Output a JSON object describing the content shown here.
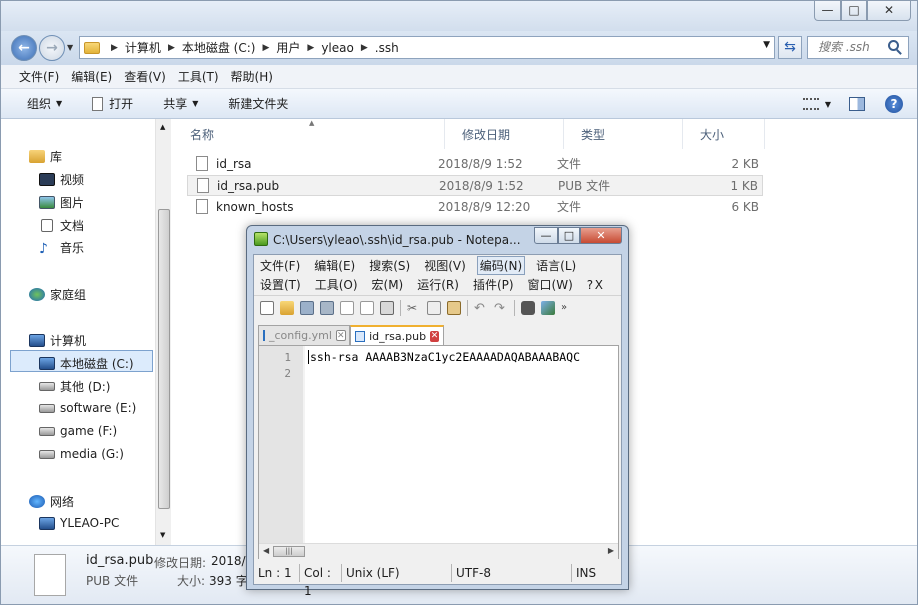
{
  "explorer": {
    "window_controls": {
      "minimize": "—",
      "maximize": "□",
      "close": "✕"
    },
    "breadcrumb": [
      "计算机",
      "本地磁盘 (C:)",
      "用户",
      "yleao",
      ".ssh"
    ],
    "search_placeholder": "搜索 .ssh",
    "menu": [
      "文件(F)",
      "编辑(E)",
      "查看(V)",
      "工具(T)",
      "帮助(H)"
    ],
    "toolbar": {
      "organize": "组织",
      "open": "打开",
      "share": "共享",
      "new_folder": "新建文件夹"
    },
    "nav": {
      "library": "库",
      "video": "视频",
      "pictures": "图片",
      "documents": "文档",
      "music": "音乐",
      "homegroup": "家庭组",
      "computer": "计算机",
      "drive_c": "本地磁盘 (C:)",
      "drive_d": "其他 (D:)",
      "drive_e": "software (E:)",
      "drive_f": "game (F:)",
      "drive_g": "media (G:)",
      "network": "网络",
      "pc": "YLEAO-PC"
    },
    "columns": {
      "name": "名称",
      "date": "修改日期",
      "type": "类型",
      "size": "大小"
    },
    "files": [
      {
        "name": "id_rsa",
        "date": "2018/8/9 1:52",
        "type": "文件",
        "size": "2 KB"
      },
      {
        "name": "id_rsa.pub",
        "date": "2018/8/9 1:52",
        "type": "PUB 文件",
        "size": "1 KB"
      },
      {
        "name": "known_hosts",
        "date": "2018/8/9 12:20",
        "type": "文件",
        "size": "6 KB"
      }
    ],
    "details": {
      "name": "id_rsa.pub",
      "type": "PUB 文件",
      "modified_label": "修改日期:",
      "modified_value": "2018/8/",
      "size_label": "大小:",
      "size_value": "393 字"
    }
  },
  "notepad": {
    "title": "C:\\Users\\yleao\\.ssh\\id_rsa.pub - Notepa...",
    "menu_row1": [
      "文件(F)",
      "编辑(E)",
      "搜索(S)",
      "视图(V)",
      "编码(N)",
      "语言(L)"
    ],
    "menu_row2": [
      "设置(T)",
      "工具(O)",
      "宏(M)",
      "运行(R)",
      "插件(P)",
      "窗口(W)",
      "?",
      "X"
    ],
    "tabs": [
      "_config.yml",
      "id_rsa.pub"
    ],
    "line_numbers": [
      "1",
      "2"
    ],
    "code_line1": "ssh-rsa AAAAB3NzaC1yc2EAAAADAQABAAABAQC",
    "status": {
      "pos": "Ln : 1",
      "col": "Col : 1",
      "eol": "Unix (LF)",
      "encoding": "UTF-8",
      "mode": "INS"
    }
  }
}
